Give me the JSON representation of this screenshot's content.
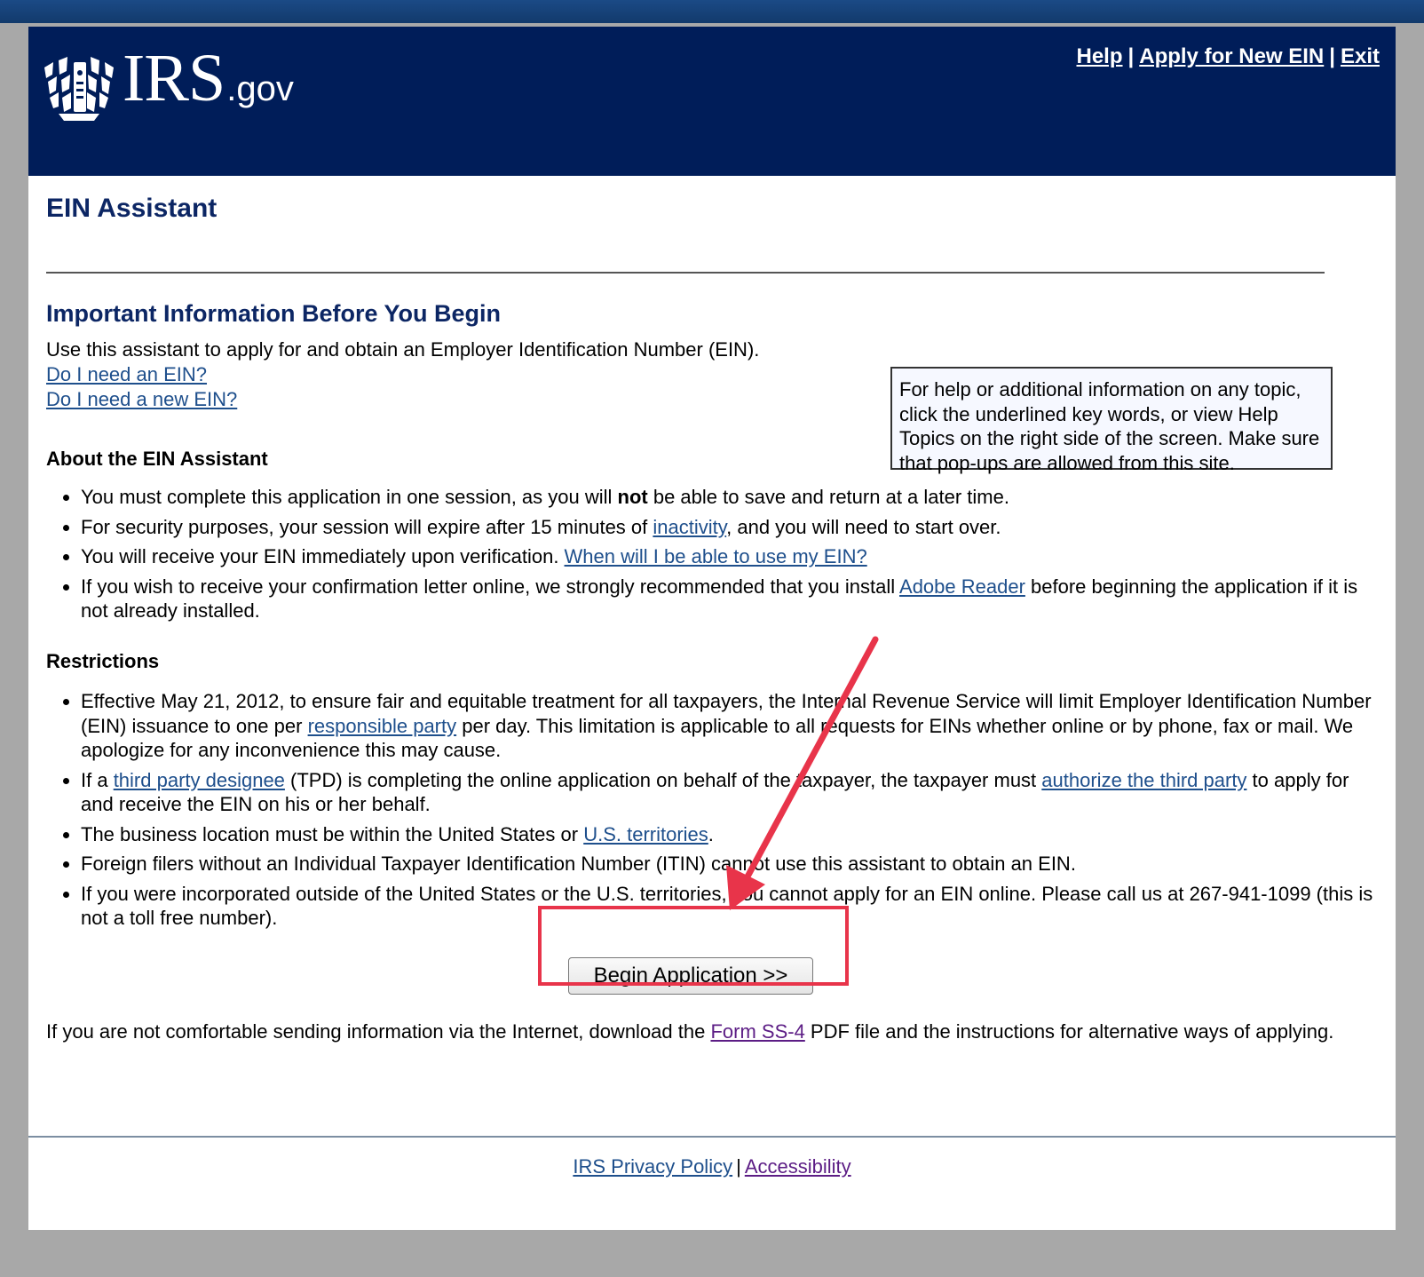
{
  "header": {
    "logo_text": "IRS",
    "logo_suffix": ".gov",
    "links": {
      "help": "Help",
      "apply_new": "Apply for New EIN",
      "exit": "Exit",
      "separator": "|"
    }
  },
  "page_title": "EIN Assistant",
  "important": {
    "title": "Important Information Before You Begin",
    "intro": "Use this assistant to apply for and obtain an Employer Identification Number (EIN).",
    "link_need_ein": "Do I need an EIN?",
    "link_need_new_ein": "Do I need a new EIN?"
  },
  "help_box": "For help or additional information on any topic, click the underlined key words, or view Help Topics on the right side of the screen. Make sure that pop-ups are allowed from this site.",
  "about": {
    "heading": "About the EIN Assistant",
    "b1_pre": "You must complete this application in one session, as you will ",
    "b1_bold": "not",
    "b1_post": " be able to save and return at a later time.",
    "b2_pre": "For security purposes, your session will expire after 15 minutes of ",
    "b2_link": "inactivity",
    "b2_post": ", and you will need to start over.",
    "b3_pre": "You will receive your EIN immediately upon verification. ",
    "b3_link": "When will I be able to use my EIN?",
    "b4_pre": "If you wish to receive your confirmation letter online, we strongly recommended that you install ",
    "b4_link": "Adobe Reader",
    "b4_post": " before beginning the application if it is not already installed."
  },
  "restrictions": {
    "heading": "Restrictions",
    "r1_pre": "Effective May 21, 2012, to ensure fair and equitable treatment for all taxpayers, the Internal Revenue Service will limit Employer Identification Number (EIN) issuance to one per ",
    "r1_link": "responsible party",
    "r1_post": " per day. This limitation is applicable to all requests for EINs whether online or by phone, fax or mail.  We apologize for any inconvenience this may cause.",
    "r2_pre": "If a ",
    "r2_link1": "third party designee",
    "r2_mid": " (TPD) is completing the online application on behalf of the taxpayer, the taxpayer must ",
    "r2_link2": "authorize the third party",
    "r2_post": " to apply for and receive the EIN on his or her behalf.",
    "r3_pre": "The business location must be within the United States or ",
    "r3_link": "U.S. territories",
    "r3_post": ".",
    "r4": "Foreign filers without an Individual Taxpayer Identification Number (ITIN) cannot use this assistant to obtain an EIN.",
    "r5": "If you were incorporated outside of the United States or the U.S. territories, you cannot apply for an EIN online. Please call us at 267-941-1099 (this is not a toll free number)."
  },
  "begin_button": "Begin Application >>",
  "footnote": {
    "pre": "If you are not comfortable sending information via the Internet, download the ",
    "link": "Form SS-4",
    "post": " PDF file and the instructions for alternative ways of applying."
  },
  "footer": {
    "privacy": "IRS Privacy Policy",
    "separator": "|",
    "accessibility": "Accessibility"
  },
  "colors": {
    "header_bg": "#001d59",
    "title_blue": "#0c2664",
    "link_blue": "#1e4f8c",
    "visited_purple": "#5c1d85",
    "highlight_red": "#e8344a"
  }
}
